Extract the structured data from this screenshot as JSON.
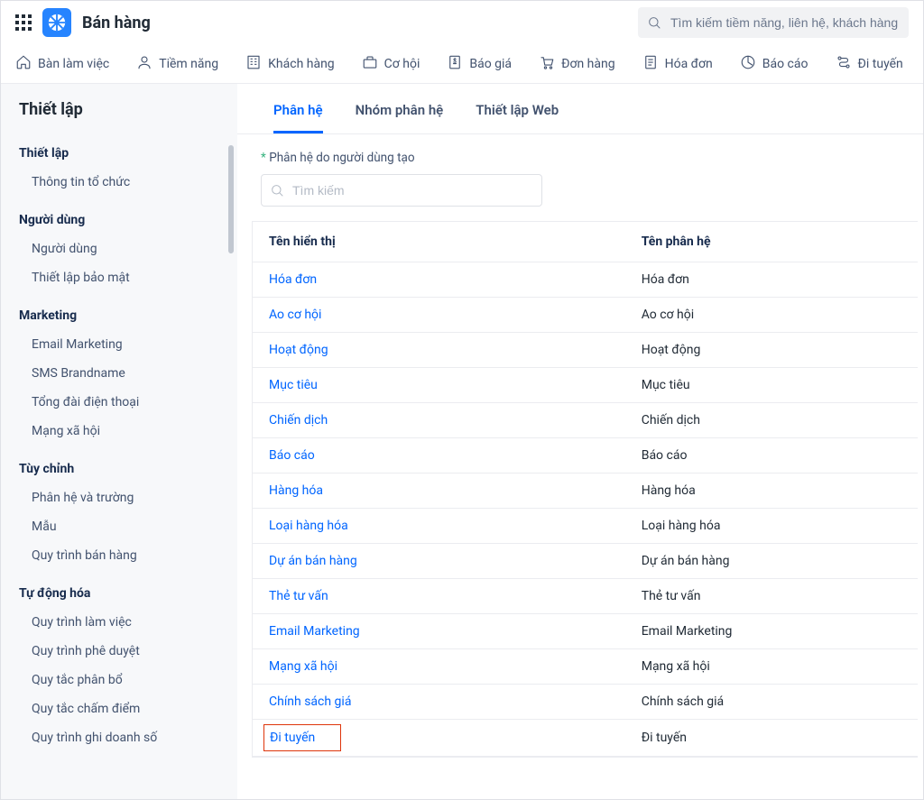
{
  "header": {
    "appTitle": "Bán hàng",
    "searchPlaceholder": "Tìm kiếm tiềm năng, liên hệ, khách hàng"
  },
  "mainNav": [
    {
      "label": "Bàn làm việc",
      "icon": "home-icon"
    },
    {
      "label": "Tiềm năng",
      "icon": "user-icon"
    },
    {
      "label": "Khách hàng",
      "icon": "building-icon"
    },
    {
      "label": "Cơ hội",
      "icon": "briefcase-icon"
    },
    {
      "label": "Báo giá",
      "icon": "quote-icon"
    },
    {
      "label": "Đơn hàng",
      "icon": "cart-icon"
    },
    {
      "label": "Hóa đơn",
      "icon": "invoice-icon"
    },
    {
      "label": "Báo cáo",
      "icon": "report-icon"
    },
    {
      "label": "Đi tuyến",
      "icon": "route-icon"
    }
  ],
  "sidebar": {
    "title": "Thiết lập",
    "sections": [
      {
        "label": "Thiết lập",
        "items": [
          "Thông tin tổ chức"
        ]
      },
      {
        "label": "Người dùng",
        "items": [
          "Người dùng",
          "Thiết lập bảo mật"
        ]
      },
      {
        "label": "Marketing",
        "items": [
          "Email Marketing",
          "SMS Brandname",
          "Tổng đài điện thoại",
          "Mạng xã hội"
        ]
      },
      {
        "label": "Tùy chỉnh",
        "items": [
          "Phân hệ và trường",
          "Mẫu",
          "Quy trình bán hàng"
        ]
      },
      {
        "label": "Tự động hóa",
        "items": [
          "Quy trình làm việc",
          "Quy trình phê duyệt",
          "Quy tắc phân bổ",
          "Quy tắc chấm điểm",
          "Quy trình ghi doanh số"
        ]
      }
    ]
  },
  "content": {
    "tabs": [
      {
        "label": "Phân hệ",
        "active": true
      },
      {
        "label": "Nhóm phân hệ",
        "active": false
      },
      {
        "label": "Thiết lập Web",
        "active": false
      }
    ],
    "note": "Phân hệ do người dùng tạo",
    "search2Placeholder": "Tìm kiếm",
    "columns": [
      "Tên hiển thị",
      "Tên phân hệ"
    ],
    "rows": [
      {
        "display": "Hóa đơn",
        "module": "Hóa đơn",
        "highlight": false
      },
      {
        "display": "Ao cơ hội",
        "module": "Ao cơ hội",
        "highlight": false
      },
      {
        "display": "Hoạt động",
        "module": "Hoạt động",
        "highlight": false
      },
      {
        "display": "Mục tiêu",
        "module": "Mục tiêu",
        "highlight": false
      },
      {
        "display": "Chiến dịch",
        "module": "Chiến dịch",
        "highlight": false
      },
      {
        "display": "Báo cáo",
        "module": "Báo cáo",
        "highlight": false
      },
      {
        "display": "Hàng hóa",
        "module": "Hàng hóa",
        "highlight": false
      },
      {
        "display": "Loại hàng hóa",
        "module": "Loại hàng hóa",
        "highlight": false
      },
      {
        "display": "Dự án bán hàng",
        "module": "Dự án bán hàng",
        "highlight": false
      },
      {
        "display": "Thẻ tư vấn",
        "module": "Thẻ tư vấn",
        "highlight": false
      },
      {
        "display": "Email Marketing",
        "module": "Email Marketing",
        "highlight": false
      },
      {
        "display": "Mạng xã hội",
        "module": "Mạng xã hội",
        "highlight": false
      },
      {
        "display": "Chính sách giá",
        "module": "Chính sách giá",
        "highlight": false
      },
      {
        "display": "Đi tuyến",
        "module": "Đi tuyến",
        "highlight": true
      }
    ]
  }
}
